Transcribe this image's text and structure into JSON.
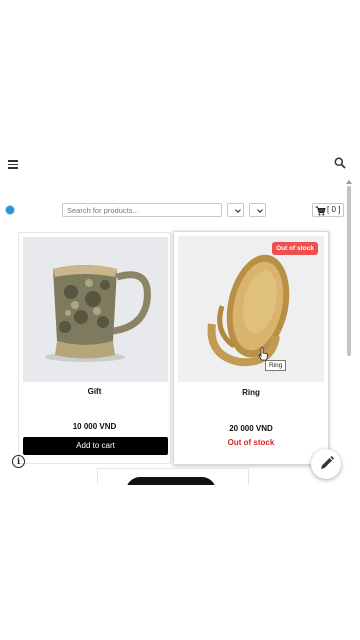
{
  "header": {
    "menu_icon": "hamburger-menu-icon",
    "search_icon": "magnifier-icon"
  },
  "toolbar": {
    "search_placeholder": "Search for products...",
    "cart_count": "[ 0 ]"
  },
  "products": [
    {
      "name": "Gift",
      "price": "10 000 VND",
      "button": "Add to cart"
    },
    {
      "name": "Ring",
      "price": "20 000 VND",
      "badge": "Out of stock",
      "status": "Out of stock",
      "tooltip": "Ring"
    }
  ],
  "colors": {
    "badge_bg": "#ef4f4f",
    "oos_text": "#e02020",
    "button_bg": "#000000"
  }
}
